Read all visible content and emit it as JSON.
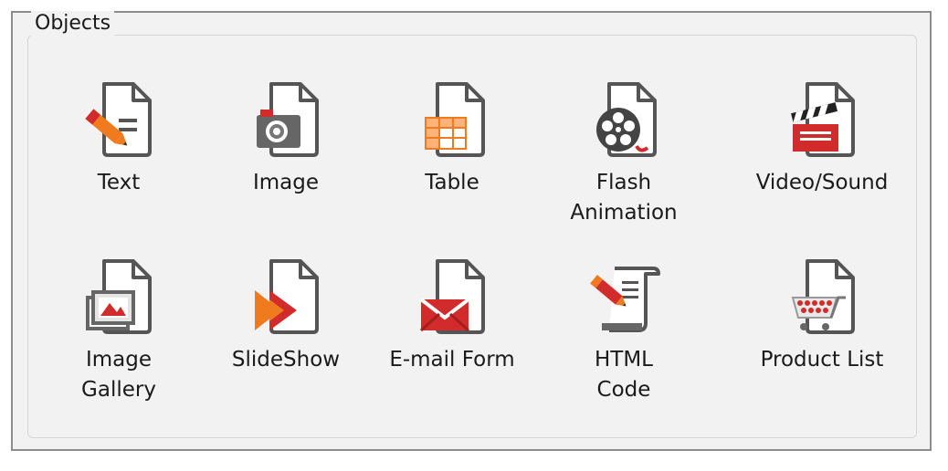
{
  "group": {
    "title": "Objects"
  },
  "objects": [
    {
      "label": "Text",
      "icon": "text-object-icon"
    },
    {
      "label": "Image",
      "icon": "image-object-icon"
    },
    {
      "label": "Table",
      "icon": "table-object-icon"
    },
    {
      "label": "Flash\nAnimation",
      "icon": "flash-animation-icon"
    },
    {
      "label": "Video/Sound",
      "icon": "video-sound-icon"
    },
    {
      "label": "Image\nGallery",
      "icon": "image-gallery-icon"
    },
    {
      "label": "SlideShow",
      "icon": "slideshow-icon"
    },
    {
      "label": "E-mail Form",
      "icon": "email-form-icon"
    },
    {
      "label": "HTML\nCode",
      "icon": "html-code-icon"
    },
    {
      "label": "Product List",
      "icon": "product-list-icon"
    }
  ],
  "colors": {
    "accent_orange": "#f07a1e",
    "accent_red": "#d12b2b",
    "icon_gray": "#555555",
    "panel_bg": "#f2f2f2",
    "frame_border": "#8c8c8c"
  }
}
